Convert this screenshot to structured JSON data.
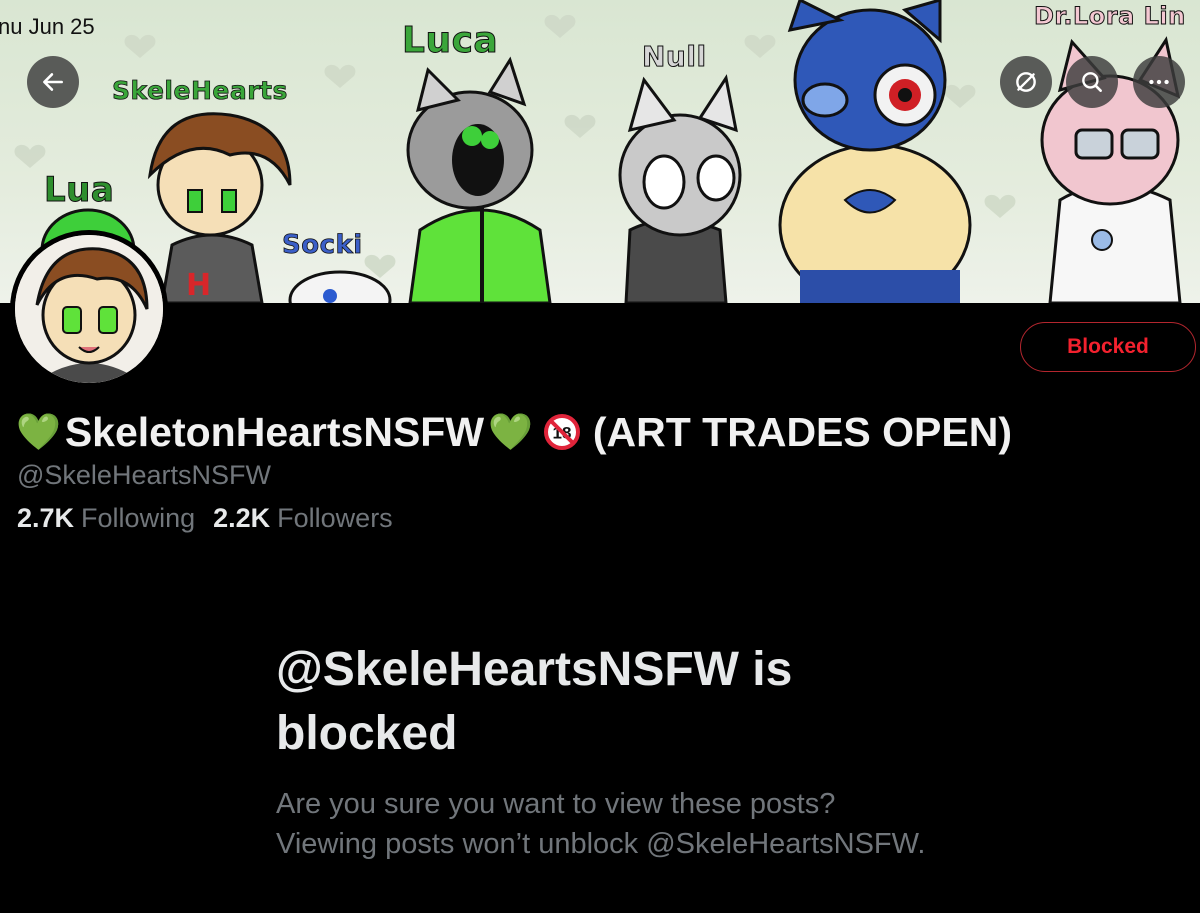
{
  "status_bar": {
    "time": "nu Jun 25"
  },
  "banner": {
    "character_names": [
      "Lua",
      "SkeleHearts",
      "Socki",
      "Luca",
      "Null",
      "Dr.Lora Lin"
    ],
    "name_color": "#3aa63a",
    "accent_green": "#5fe23a"
  },
  "nav": {
    "back_icon": "arrow-left-icon",
    "grok_icon": "slash-circle-icon",
    "search_icon": "search-icon",
    "more_icon": "more-horizontal-icon"
  },
  "profile": {
    "avatar_icon": "avatar-drawing",
    "display_name_prefix": "💚",
    "display_name": "SkeletonHeartsNSFW",
    "display_name_suffix": "💚",
    "adult_icon": "no-under-18-icon",
    "display_name_tag": "(ART TRADES OPEN)",
    "handle": "@SkeleHeartsNSFW",
    "following_count": "2.7K",
    "following_label": "Following",
    "followers_count": "2.2K",
    "followers_label": "Followers",
    "blocked_button_label": "Blocked",
    "blocked_color": "#f4212e"
  },
  "notice": {
    "title": "@SkeleHeartsNSFW is blocked",
    "body": "Are you sure you want to view these posts? Viewing posts won’t unblock @SkeleHeartsNSFW."
  }
}
